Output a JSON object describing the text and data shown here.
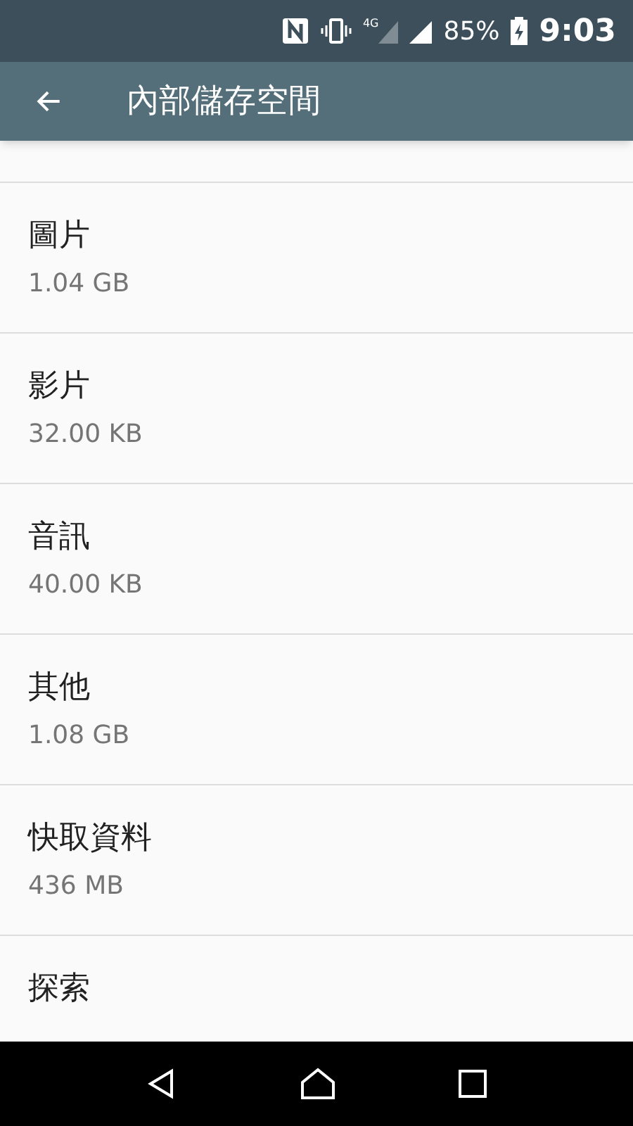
{
  "status_bar": {
    "network": "4G",
    "battery": "85%",
    "time": "9:03"
  },
  "app_bar": {
    "title": "內部儲存空間"
  },
  "items": [
    {
      "title": "圖片",
      "size": "1.04 GB"
    },
    {
      "title": "影片",
      "size": "32.00 KB"
    },
    {
      "title": "音訊",
      "size": "40.00 KB"
    },
    {
      "title": "其他",
      "size": "1.08 GB"
    },
    {
      "title": "快取資料",
      "size": "436 MB"
    },
    {
      "title": "探索"
    }
  ]
}
